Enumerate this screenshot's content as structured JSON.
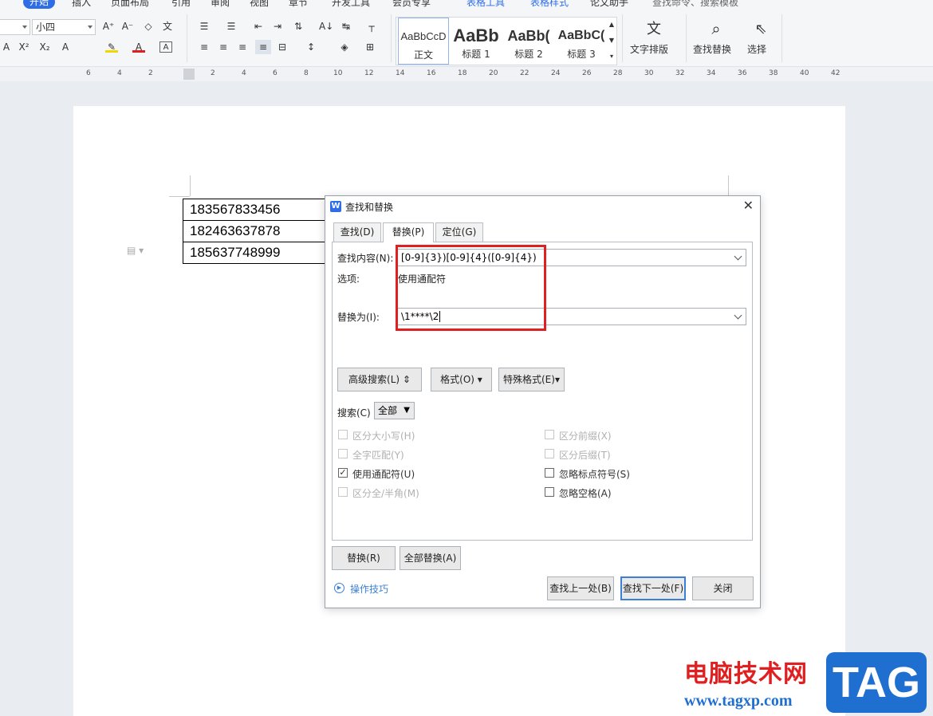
{
  "menu": {
    "tabs": [
      "开始",
      "插入",
      "页面布局",
      "引用",
      "审阅",
      "视图",
      "章节",
      "开发工具",
      "会员专享",
      "表格工具",
      "表格样式",
      "论文助手"
    ],
    "search": "查找命令、搜索模板"
  },
  "ribbon": {
    "font_size": "小四",
    "styles": [
      {
        "preview": "AaBbCcD",
        "name": "正文"
      },
      {
        "preview": "AaBb",
        "name": "标题 1"
      },
      {
        "preview": "AaBb(",
        "name": "标题 2"
      },
      {
        "preview": "AaBbC(",
        "name": "标题 3"
      }
    ],
    "text_layout": "文字排版",
    "find_replace": "查找替换",
    "select": "选择"
  },
  "ruler": [
    "6",
    "4",
    "2",
    "2",
    "4",
    "6",
    "8",
    "10",
    "12",
    "14",
    "16",
    "18",
    "20",
    "22",
    "24",
    "26",
    "28",
    "30",
    "32",
    "34",
    "36",
    "38",
    "40",
    "42"
  ],
  "table": {
    "rows": [
      "183567833456",
      "182463637878",
      "185637748999"
    ]
  },
  "dialog": {
    "title": "查找和替换",
    "tabs": [
      "查找(D)",
      "替换(P)",
      "定位(G)"
    ],
    "find_label": "查找内容(N):",
    "find_value": "[0-9]{3})[0-9]{4}([0-9]{4})",
    "options_label": "选项:",
    "options_value": "使用通配符",
    "replace_label": "替换为(I):",
    "replace_value": "\\1****\\2",
    "advanced_button": "高级搜索(L)",
    "format_button": "格式(O)",
    "special_button": "特殊格式(E)",
    "search_label": "搜索(C)",
    "search_scope": "全部",
    "checkboxes_left": [
      {
        "label": "区分大小写(H)",
        "checked": false,
        "enabled": false
      },
      {
        "label": "全字匹配(Y)",
        "checked": false,
        "enabled": false
      },
      {
        "label": "使用通配符(U)",
        "checked": true,
        "enabled": true
      },
      {
        "label": "区分全/半角(M)",
        "checked": false,
        "enabled": false
      }
    ],
    "checkboxes_right": [
      {
        "label": "区分前缀(X)",
        "checked": false,
        "enabled": false
      },
      {
        "label": "区分后缀(T)",
        "checked": false,
        "enabled": false
      },
      {
        "label": "忽略标点符号(S)",
        "checked": false,
        "enabled": true
      },
      {
        "label": "忽略空格(A)",
        "checked": false,
        "enabled": true
      }
    ],
    "replace_button": "替换(R)",
    "replace_all_button": "全部替换(A)",
    "tips_link": "操作技巧",
    "find_prev_button": "查找上一处(B)",
    "find_next_button": "查找下一处(F)",
    "close_button": "关闭"
  },
  "watermark": {
    "site_name": "电脑技术网",
    "url": "www.tagxp.com",
    "badge": "TAG"
  }
}
